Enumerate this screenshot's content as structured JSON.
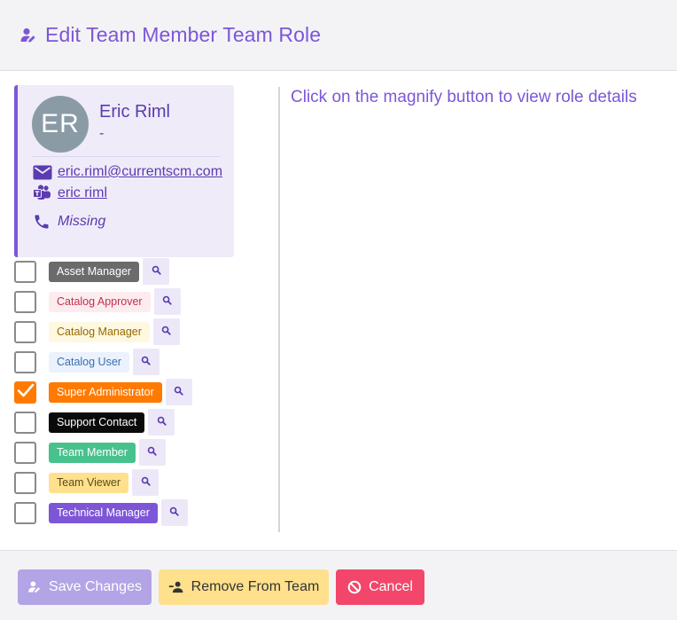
{
  "header": {
    "title": "Edit Team Member Team Role",
    "icon": "user-edit-icon"
  },
  "person": {
    "initials": "ER",
    "name": "Eric Riml",
    "subtitle": "-",
    "email": "eric.riml@currentscm.com",
    "teams": "eric riml",
    "phone": "Missing"
  },
  "hint": "Click on the magnify button to view role details",
  "roles": [
    {
      "label": "Asset Manager",
      "checked": false,
      "bg": "#6b6b6b",
      "fg": "#ffffff"
    },
    {
      "label": "Catalog Approver",
      "checked": false,
      "bg": "#fdecef",
      "fg": "#c0304e"
    },
    {
      "label": "Catalog Manager",
      "checked": false,
      "bg": "#fff8e1",
      "fg": "#946b00"
    },
    {
      "label": "Catalog User",
      "checked": false,
      "bg": "#eaf2fd",
      "fg": "#3b6fb0"
    },
    {
      "label": "Super Administrator",
      "checked": true,
      "bg": "#ff7a00",
      "fg": "#ffffff"
    },
    {
      "label": "Support Contact",
      "checked": false,
      "bg": "#0a0a0a",
      "fg": "#ffffff"
    },
    {
      "label": "Team Member",
      "checked": false,
      "bg": "#48c28d",
      "fg": "#ffffff"
    },
    {
      "label": "Team Viewer",
      "checked": false,
      "bg": "#ffe08c",
      "fg": "#5a4a1a"
    },
    {
      "label": "Technical Manager",
      "checked": false,
      "bg": "#7d56d8",
      "fg": "#ffffff"
    }
  ],
  "footer": {
    "save_label": "Save Changes",
    "remove_label": "Remove From Team",
    "cancel_label": "Cancel"
  },
  "colors": {
    "accent": "#7d56d8",
    "checked": "#ff7a00",
    "cancel": "#f2476a",
    "remove": "#ffe08c",
    "save_disabled": "#b3a4e6"
  }
}
